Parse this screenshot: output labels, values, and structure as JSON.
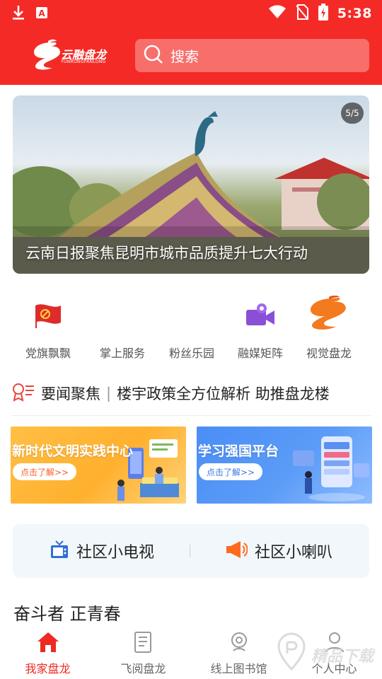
{
  "status_bar": {
    "time": "5:38",
    "icons": [
      "download-icon",
      "app-a-icon",
      "wifi-icon",
      "no-sim-icon",
      "battery-charging-icon"
    ]
  },
  "header": {
    "logo_text": "云融盘龙",
    "logo_subtext": "YUNRONGPANLONG",
    "search_placeholder": "搜索",
    "accent_color": "#f42a26"
  },
  "banner": {
    "counter": "5/5",
    "caption": "云南日报聚焦昆明市城市品质提升七大行动"
  },
  "quick_links": [
    {
      "label": "党旗飘飘",
      "icon": "party-flag-icon"
    },
    {
      "label": "掌上服务",
      "icon": "blank-icon"
    },
    {
      "label": "粉丝乐园",
      "icon": "blank-icon"
    },
    {
      "label": "融媒矩阵",
      "icon": "video-camera-icon"
    },
    {
      "label": "视觉盘龙",
      "icon": "dragon-logo-icon"
    }
  ],
  "ticker": {
    "label": "要闻聚焦",
    "separator": "|",
    "headline": "楼宇政策全方位解析 助推盘龙楼"
  },
  "promos": [
    {
      "title": "新时代文明实践中心",
      "button": "点击了解>>"
    },
    {
      "title": "学习强国平台",
      "button": "点击了解>>"
    }
  ],
  "community": [
    {
      "label": "社区小电视",
      "icon": "tv-icon"
    },
    {
      "label": "社区小喇叭",
      "icon": "megaphone-icon"
    }
  ],
  "section_title": "奋斗者 正青春",
  "bottom_nav": [
    {
      "label": "我家盘龙",
      "icon": "home-icon",
      "active": true
    },
    {
      "label": "飞阅盘龙",
      "icon": "document-icon",
      "active": false
    },
    {
      "label": "线上图书馆",
      "icon": "library-icon",
      "active": false
    },
    {
      "label": "个人中心",
      "icon": "user-icon",
      "active": false
    }
  ],
  "watermark": "精品下载"
}
